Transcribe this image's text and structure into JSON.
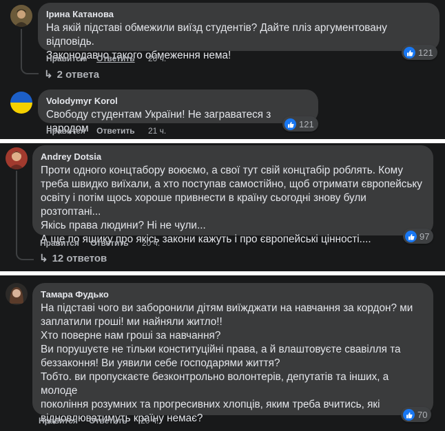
{
  "colors": {
    "background": "#18191a",
    "bubble": "#3a3b3c",
    "text": "#e4e6eb",
    "secondary": "#b0b3b8",
    "like": "#1877f2"
  },
  "comments": [
    {
      "author": "Ірина Катанова",
      "text": "На якій підставі обмежили виїзд студентів? Дайте пліз аргументовану відповідь.\nЗаконодавчо такого обмеження нема!",
      "like_label": "Нравится",
      "reply_label": "Ответить",
      "time": "20 ч.",
      "reaction_icon": "thumbs-up-icon",
      "reactions": "121",
      "replies": "2 ответа"
    },
    {
      "author": "Volodymyr Korol",
      "text": "Свободу студентам України! Не заграватеся з народом",
      "like_label": "Нравится",
      "reply_label": "Ответить",
      "time": "21 ч.",
      "reaction_icon": "thumbs-up-icon",
      "reactions": "121"
    },
    {
      "author": "Andrey Dotsia",
      "text": "Проти одного концтабору воюємо, а свої тут свій концтабір роблять. Кому\nтреба швидко виїхали, а хто поступав самостійно, щоб отримати європейську\nосвіту і потім щось хороше привнести в країну сьогодні знову були розтоптані...\nЯкісь права людини? Ні не чули...\nА ще по ящику про якісь закони кажуть і про європейські цінності....",
      "like_label": "Нравится",
      "reply_label": "Ответить",
      "time": "20 ч.",
      "reaction_icon": "thumbs-up-icon",
      "reactions": "97",
      "replies": "12 ответов"
    },
    {
      "author": "Тамара Фудько",
      "text": "На підставі чого ви заборонили дітям виїжджати на навчання за кордон? ми\nзаплатили гроші! ми найняли житло!!\nХто поверне нам гроші за навчання?\nВи порушуєте не тільки конституційні права, а й влаштовуєте свавілля та\nбеззаконня! Ви уявили себе господарями життя?\nТобто. ви пропускаєте безконтрольно волонтерів, депутатів та інших, а молоде\nпокоління розумних та прогресивних хлопців, яким треба вчитись, які\nвідновлюватимуть країну немає?",
      "like_label": "Нравится",
      "reply_label": "Ответить",
      "time": "20 ч.",
      "reaction_icon": "thumbs-up-icon",
      "reactions": "70"
    }
  ]
}
